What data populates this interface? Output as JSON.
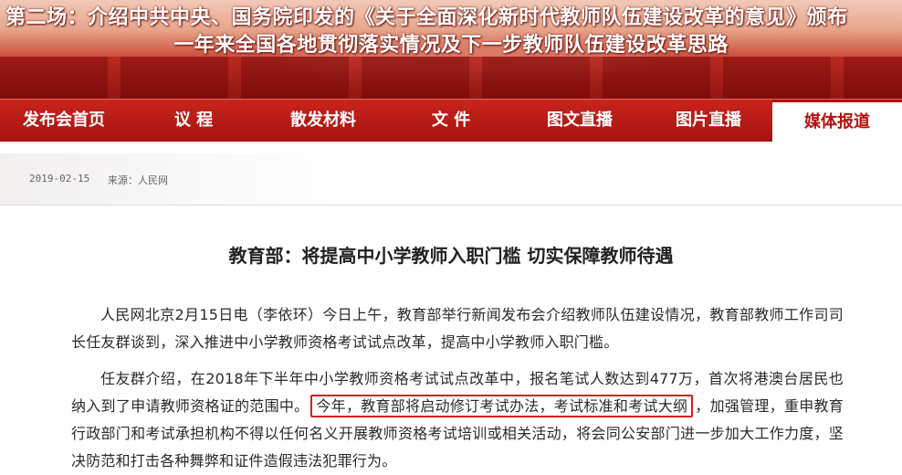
{
  "banner": {
    "title_line1": "第二场：介绍中共中央、国务院印发的《关于全面深化新时代教师队伍建设改革的意见》颁布",
    "title_line2": "一年来全国各地贯彻落实情况及下一步教师队伍建设改革思路"
  },
  "nav": {
    "items": [
      {
        "label": "发布会首页",
        "active": false
      },
      {
        "label": "议 程",
        "active": false
      },
      {
        "label": "散发材料",
        "active": false
      },
      {
        "label": "文 件",
        "active": false
      },
      {
        "label": "图文直播",
        "active": false
      },
      {
        "label": "图片直播",
        "active": false
      },
      {
        "label": "媒体报道",
        "active": true
      }
    ]
  },
  "meta": {
    "date": "2019-02-15",
    "source": "来源：人民网"
  },
  "article": {
    "headline": "教育部：将提高中小学教师入职门槛 切实保障教师待遇",
    "paragraph1": "人民网北京2月15日电（李依环）今日上午，教育部举行新闻发布会介绍教师队伍建设情况，教育部教师工作司司长任友群谈到，深入推进中小学教师资格考试试点改革，提高中小学教师入职门槛。",
    "paragraph2_before": "任友群介绍，在2018年下半年中小学教师资格考试试点改革中，报名笔试人数达到477万，首次将港澳台居民也纳入到了申请教师资格证的范围中。",
    "paragraph2_highlight": "今年，教育部将启动修订考试办法，考试标准和考试大纲",
    "paragraph2_after": "，加强管理，重申教育行政部门和考试承担机构不得以任何名义开展教师资格考试培训或相关活动，将会同公安部门进一步加大工作力度，坚决防范和打击各种舞弊和证件造假违法犯罪行为。"
  },
  "colors": {
    "nav_red": "#b5120e",
    "highlight_border": "#d81e1e"
  }
}
